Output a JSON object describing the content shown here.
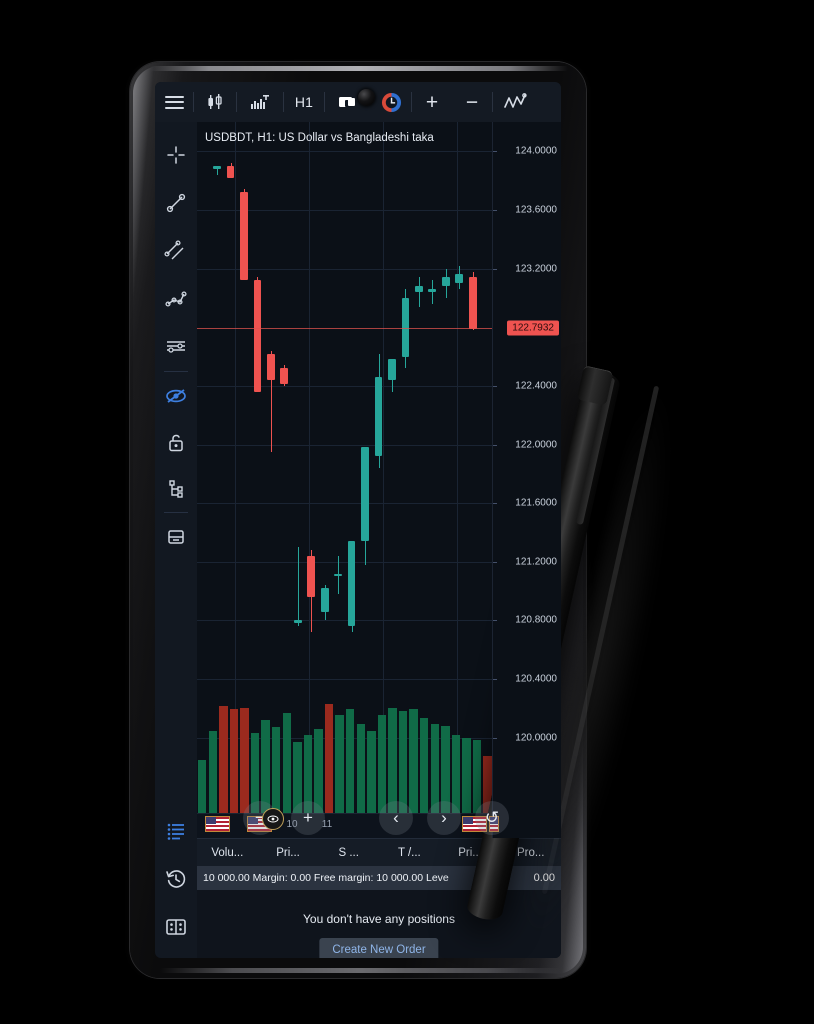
{
  "app": {
    "platform": "mobile-trading-terminal",
    "device": "phone-with-stylus"
  },
  "toolbar": {
    "menu_icon": "hamburger-menu-icon",
    "chart_type_icon": "candlestick-chart-icon",
    "indicator_icon": "bar-chart-t-icon",
    "timeframe_label": "H1",
    "objects_icon": "objects-crop-icon",
    "alarm_icon": "alarm-clock-icon",
    "zoom_in_label": "+",
    "zoom_out_label": "−",
    "indicators_icon": "trend-wave-icon"
  },
  "sidebar": {
    "items": [
      {
        "name": "crosshair-tool",
        "icon": "crosshair-icon",
        "active": false
      },
      {
        "name": "trendline-tool",
        "icon": "trendline-icon",
        "active": false
      },
      {
        "name": "parallel-channel-tool",
        "icon": "parallel-lines-icon",
        "active": false
      },
      {
        "name": "polyline-tool",
        "icon": "polyline-icon",
        "active": false
      },
      {
        "name": "levels-tool",
        "icon": "fibonacci-levels-icon",
        "active": false
      },
      {
        "name": "hide-objects-tool",
        "icon": "eye-slash-icon",
        "active": true
      },
      {
        "name": "lock-objects-tool",
        "icon": "unlock-icon",
        "active": false
      },
      {
        "name": "object-tree-tool",
        "icon": "object-tree-icon",
        "active": false
      },
      {
        "name": "delete-objects-tool",
        "icon": "drawer-delete-icon",
        "active": false
      }
    ],
    "bottom_items": [
      {
        "name": "trade-list",
        "icon": "list-icon",
        "active": true
      },
      {
        "name": "history",
        "icon": "history-clock-icon",
        "active": false
      },
      {
        "name": "news-book",
        "icon": "book-grid-icon",
        "active": false
      }
    ]
  },
  "chart": {
    "title": "USDBDT, H1: US Dollar vs Bangladeshi taka",
    "symbol": "USDBDT",
    "timeframe": "H1",
    "description": "US Dollar vs Bangladeshi taka",
    "current_price": "122.7932",
    "current_price_color": "#ef5350",
    "bull_color": "#26a69a",
    "bear_color": "#ef5350",
    "background": "#0b1017",
    "grid_color": "#1a2433"
  },
  "chart_data": {
    "type": "bar",
    "subtype": "candlestick-with-volume",
    "title": "USDBDT, H1: US Dollar vs Bangladeshi taka",
    "xlabel": "",
    "ylabel": "",
    "ylim": [
      119.8,
      124.2
    ],
    "grid": true,
    "legend": "none",
    "y_ticks": [
      "124.0000",
      "123.6000",
      "123.2000",
      "122.4000",
      "122.0000",
      "121.6000",
      "121.2000",
      "120.8000",
      "120.4000",
      "120.0000"
    ],
    "x_ticks": [
      "10",
      "11",
      "11"
    ],
    "current_price_line": 122.7932,
    "candles": [
      {
        "o": 123.88,
        "h": 123.9,
        "l": 123.84,
        "c": 123.9,
        "dir": "up",
        "v": 34
      },
      {
        "o": 123.9,
        "h": 123.92,
        "l": 123.82,
        "c": 123.82,
        "dir": "down",
        "v": 46
      },
      {
        "o": 123.72,
        "h": 123.74,
        "l": 123.12,
        "c": 123.12,
        "dir": "down",
        "v": 60
      },
      {
        "o": 123.12,
        "h": 123.14,
        "l": 122.36,
        "c": 122.36,
        "dir": "down",
        "v": 58
      },
      {
        "o": 122.62,
        "h": 122.64,
        "l": 121.95,
        "c": 122.44,
        "dir": "down",
        "v": 59
      },
      {
        "o": 122.52,
        "h": 122.54,
        "l": 122.4,
        "c": 122.41,
        "dir": "down",
        "v": 45
      },
      {
        "o": 120.78,
        "h": 121.3,
        "l": 120.76,
        "c": 120.8,
        "dir": "up",
        "v": 52
      },
      {
        "o": 121.24,
        "h": 121.28,
        "l": 120.72,
        "c": 120.96,
        "dir": "down",
        "v": 48
      },
      {
        "o": 120.86,
        "h": 121.04,
        "l": 120.8,
        "c": 121.02,
        "dir": "up",
        "v": 56
      },
      {
        "o": 121.1,
        "h": 121.24,
        "l": 120.98,
        "c": 121.12,
        "dir": "up",
        "v": 57
      },
      {
        "o": 120.76,
        "h": 121.34,
        "l": 120.72,
        "c": 121.34,
        "dir": "up",
        "v": 61
      },
      {
        "o": 121.34,
        "h": 121.98,
        "l": 121.18,
        "c": 121.98,
        "dir": "up",
        "v": 55
      },
      {
        "o": 121.92,
        "h": 122.62,
        "l": 121.84,
        "c": 122.46,
        "dir": "up",
        "v": 58
      },
      {
        "o": 122.44,
        "h": 122.58,
        "l": 122.36,
        "c": 122.58,
        "dir": "up",
        "v": 59
      },
      {
        "o": 122.6,
        "h": 123.06,
        "l": 122.52,
        "c": 123.0,
        "dir": "up",
        "v": 58
      },
      {
        "o": 123.04,
        "h": 123.14,
        "l": 122.94,
        "c": 123.08,
        "dir": "up",
        "v": 54
      },
      {
        "o": 123.06,
        "h": 123.12,
        "l": 122.96,
        "c": 123.04,
        "dir": "up",
        "v": 53
      },
      {
        "o": 123.08,
        "h": 123.2,
        "l": 123.0,
        "c": 123.14,
        "dir": "up",
        "v": 56
      },
      {
        "o": 123.16,
        "h": 123.22,
        "l": 123.06,
        "c": 123.1,
        "dir": "up",
        "v": 49
      },
      {
        "o": 123.14,
        "h": 123.18,
        "l": 122.78,
        "c": 122.79,
        "dir": "down",
        "v": 40
      }
    ],
    "volume_bars": [
      {
        "v": 30,
        "dir": "up"
      },
      {
        "v": 46,
        "dir": "up"
      },
      {
        "v": 60,
        "dir": "down"
      },
      {
        "v": 58,
        "dir": "down"
      },
      {
        "v": 59,
        "dir": "down"
      },
      {
        "v": 45,
        "dir": "up"
      },
      {
        "v": 52,
        "dir": "up"
      },
      {
        "v": 48,
        "dir": "up"
      },
      {
        "v": 56,
        "dir": "up"
      },
      {
        "v": 40,
        "dir": "up"
      },
      {
        "v": 44,
        "dir": "up"
      },
      {
        "v": 47,
        "dir": "up"
      },
      {
        "v": 61,
        "dir": "down"
      },
      {
        "v": 55,
        "dir": "up"
      },
      {
        "v": 58,
        "dir": "up"
      },
      {
        "v": 50,
        "dir": "up"
      },
      {
        "v": 46,
        "dir": "up"
      },
      {
        "v": 55,
        "dir": "up"
      },
      {
        "v": 59,
        "dir": "up"
      },
      {
        "v": 57,
        "dir": "up"
      },
      {
        "v": 58,
        "dir": "up"
      },
      {
        "v": 53,
        "dir": "up"
      },
      {
        "v": 50,
        "dir": "up"
      },
      {
        "v": 49,
        "dir": "up"
      },
      {
        "v": 44,
        "dir": "up"
      },
      {
        "v": 42,
        "dir": "up"
      },
      {
        "v": 41,
        "dir": "up"
      },
      {
        "v": 32,
        "dir": "down"
      }
    ]
  },
  "chart_controls": {
    "zoom_out_label": "−",
    "zoom_in_label": "+",
    "prev_label": "‹",
    "next_label": "›",
    "reset_label": "↺",
    "event_markers": [
      {
        "name": "us-news-event",
        "icon": "us-flag-icon"
      },
      {
        "name": "us-news-event",
        "icon": "us-flag-icon"
      },
      {
        "name": "us-news-event",
        "icon": "us-flag-icon"
      },
      {
        "name": "us-news-event",
        "icon": "us-flag-icon"
      }
    ]
  },
  "table": {
    "headers": [
      "Volu...",
      "Pri...",
      "S ...",
      "T /...",
      "Pri...",
      "Pro..."
    ]
  },
  "status_bar": {
    "text": "10 000.00  Margin: 0.00  Free margin: 10 000.00  Leve",
    "profit": "0.00"
  },
  "positions": {
    "empty_message": "You don't have any positions",
    "create_order_label": "Create New Order"
  }
}
